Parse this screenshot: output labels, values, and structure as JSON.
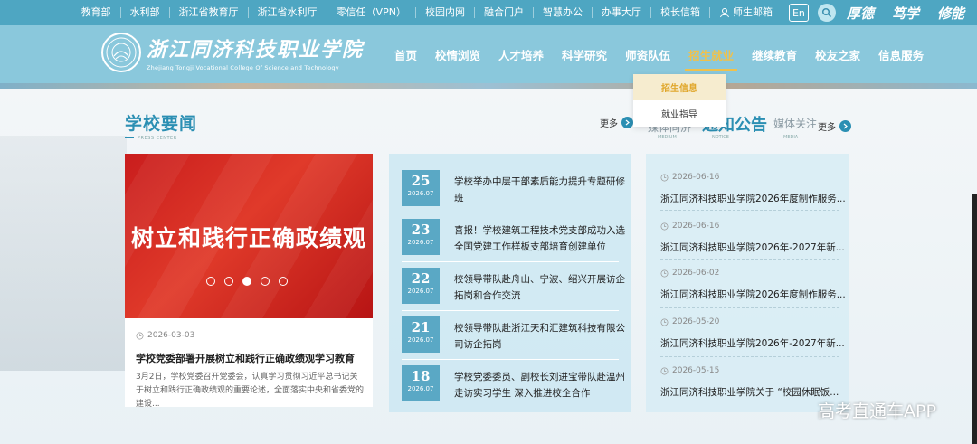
{
  "topbar": {
    "links": [
      "教育部",
      "水利部",
      "浙江省教育厅",
      "浙江省水利厅",
      "零信任（VPN）",
      "校园内网",
      "融合门户",
      "智慧办公",
      "办事大厅",
      "校长信箱"
    ],
    "mail_label": "师生邮箱",
    "en_label": "En",
    "motto": [
      "厚德",
      "笃学",
      "修能"
    ]
  },
  "header": {
    "logo_cn": "浙江同济科技职业学院",
    "logo_en": "Zhejiang Tongji Vocational College Of Science and Technology",
    "nav": [
      "首页",
      "校情浏览",
      "人才培养",
      "科学研究",
      "师资队伍",
      "招生就业",
      "继续教育",
      "校友之家",
      "信息服务"
    ],
    "active_nav": "招生就业",
    "dropdown": [
      "招生信息",
      "就业指导"
    ]
  },
  "news_section": {
    "title": "学校要闻",
    "subtitle": "PRESS CENTER",
    "more_label": "更多"
  },
  "slider": {
    "slogan": "树立和践行正确政绩观",
    "active_dot": 3,
    "dot_count": 5,
    "date": "2026-03-03",
    "title": "学校党委部署开展树立和践行正确政绩观学习教育",
    "desc": "3月2日，学校党委召开党委会，认真学习贯彻习近平总书记关于树立和践行正确政绩观的重要论述，全面落实中央和省委党的建设..."
  },
  "news_list": [
    {
      "day": "25",
      "ym": "2026.07",
      "title": "学校举办中层干部素质能力提升专题研修班"
    },
    {
      "day": "23",
      "ym": "2026.07",
      "title": "喜报！学校建筑工程技术党支部成功入选全国党建工作样板支部培育创建单位"
    },
    {
      "day": "22",
      "ym": "2026.07",
      "title": "校领导带队赴舟山、宁波、绍兴开展访企拓岗和合作交流"
    },
    {
      "day": "21",
      "ym": "2026.07",
      "title": "校领导带队赴浙江天和汇建筑科技有限公司访企拓岗"
    },
    {
      "day": "18",
      "ym": "2026.07",
      "title": "学校党委委员、副校长刘进宝带队赴温州走访实习学生 深入推进校企合作"
    }
  ],
  "notice_section": {
    "tab_media_left": "媒体同济",
    "tab_media_left_sub": "MEDIUM",
    "tab_notice": "通知公告",
    "tab_notice_sub": "NOTICE",
    "tab_media": "媒体关注",
    "tab_media_sub": "MEDIA",
    "more_label": "更多"
  },
  "notice_list": [
    {
      "date": "2026-06-16",
      "title": "浙江同济科技职业学院2026年度制作服务..."
    },
    {
      "date": "2026-06-16",
      "title": "浙江同济科技职业学院2026年-2027年新..."
    },
    {
      "date": "2026-06-02",
      "title": "浙江同济科技职业学院2026年度制作服务..."
    },
    {
      "date": "2026-05-20",
      "title": "浙江同济科技职业学院2026年-2027年新..."
    },
    {
      "date": "2026-05-15",
      "title": "浙江同济科技职业学院关于 “校园休眠饭..."
    }
  ],
  "watermark": "高考直通车APP",
  "colors": {
    "topbar": "#4ea6c2",
    "header": "#8ac8dc",
    "accent": "#2b8fb3",
    "active_nav": "#f0c14b",
    "slider_red": "#c91d1d"
  }
}
